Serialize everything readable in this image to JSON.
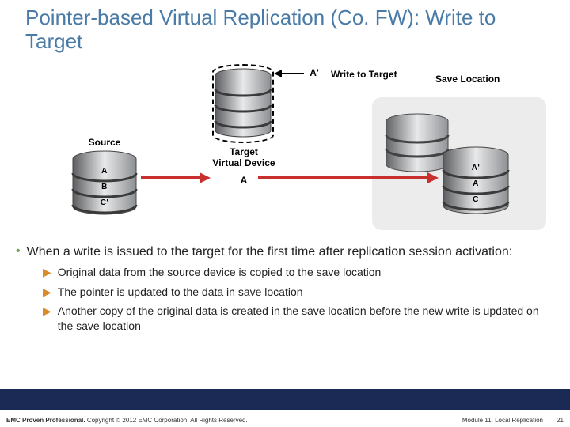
{
  "title": "Pointer-based Virtual Replication (Co. FW): Write to Target",
  "labels": {
    "source": "Source",
    "targetVirtual": "Target\nVirtual Device",
    "saveLocation": "Save Location",
    "writeTarget": "Write to Target",
    "writeLabel": "A'"
  },
  "source_layers": [
    "A",
    "B",
    "C'"
  ],
  "target_layer": "A",
  "save_layers": [
    "A'",
    "A",
    "C"
  ],
  "bullet_lead": "When a write is issued to the target for the first time after replication session activation:",
  "subs": [
    "Original data from the source device is copied to the save location",
    "The pointer is updated to the data in save location",
    "Another copy of the original data is created in the save location before the new write is updated on the save location"
  ],
  "footer": {
    "left_bold": "EMC Proven Professional.",
    "left_rest": " Copyright © 2012 EMC Corporation. All Rights Reserved.",
    "module": "Module 11: Local Replication",
    "page": "21"
  }
}
